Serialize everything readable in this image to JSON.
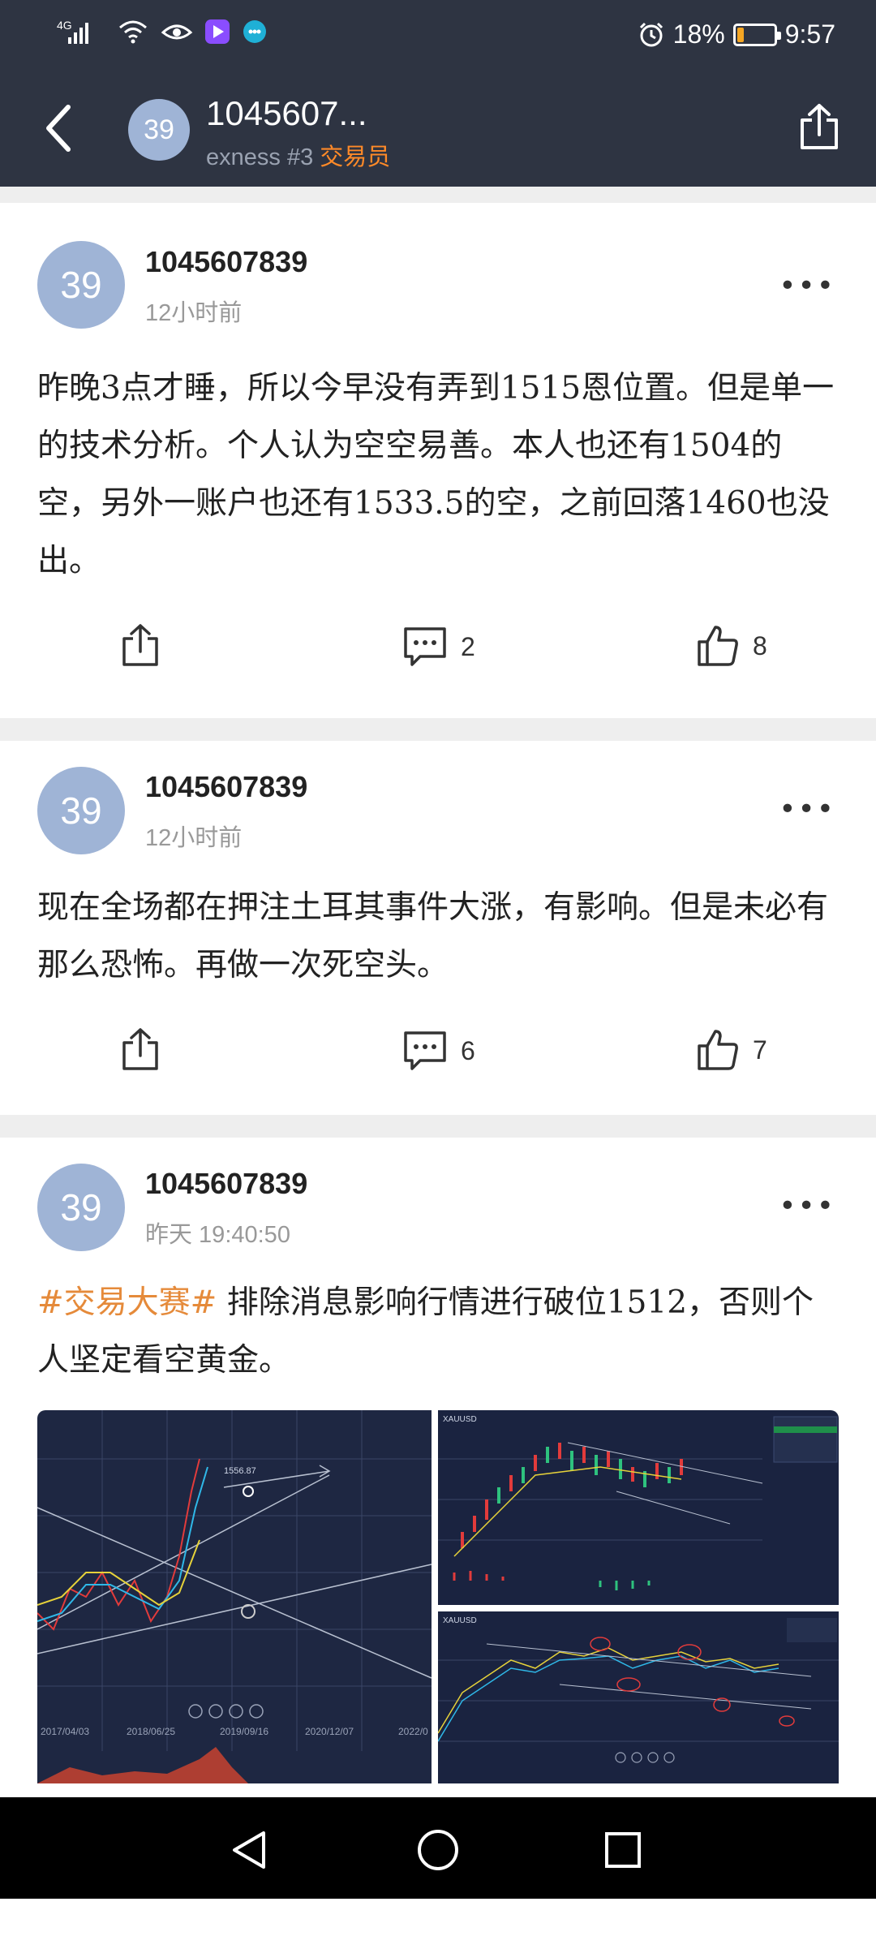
{
  "status_bar": {
    "signal_label": "4G",
    "battery_text": "18%",
    "battery_level": 0.18,
    "time": "9:57"
  },
  "header": {
    "avatar_text": "39",
    "title": "1045607...",
    "subtitle_prefix": "exness #3",
    "subtitle_role": "交易员"
  },
  "posts": [
    {
      "avatar_text": "39",
      "username": "1045607839",
      "time": "12小时前",
      "text": "昨晚3点才睡，所以今早没有弄到1515恩位置。但是单一的技术分析。个人认为空空易善。本人也还有1504的空，另外一账户也还有1533.5的空，之前回落1460也没出。",
      "comments": "2",
      "likes": "8"
    },
    {
      "avatar_text": "39",
      "username": "1045607839",
      "time": "12小时前",
      "text": "现在全场都在押注土耳其事件大涨，有影响。但是未必有那么恐怖。再做一次死空头。",
      "comments": "6",
      "likes": "7"
    },
    {
      "avatar_text": "39",
      "username": "1045607839",
      "time": "昨天 19:40:50",
      "tag": "#交易大赛#",
      "text": " 排除消息影响行情进行破位1512，否则个人坚定看空黄金。",
      "chart_labels": {
        "price_tag": "1556.87",
        "dates": [
          "2017/04/03",
          "2018/06/25",
          "2019/09/16",
          "2020/12/07",
          "2022/0"
        ],
        "symbol_1": "XAUUSD",
        "symbol_2": "XAUUSD"
      }
    }
  ],
  "icons": {
    "back": "back-arrow-icon",
    "share": "share-icon",
    "comment": "comment-icon",
    "like": "thumbs-up-icon",
    "more": "more-icon"
  },
  "colors": {
    "header_bg": "#2e3442",
    "role_accent": "#ff8a28",
    "tag_accent": "#e58a3a",
    "avatar_bg": "#9fb4d6"
  }
}
